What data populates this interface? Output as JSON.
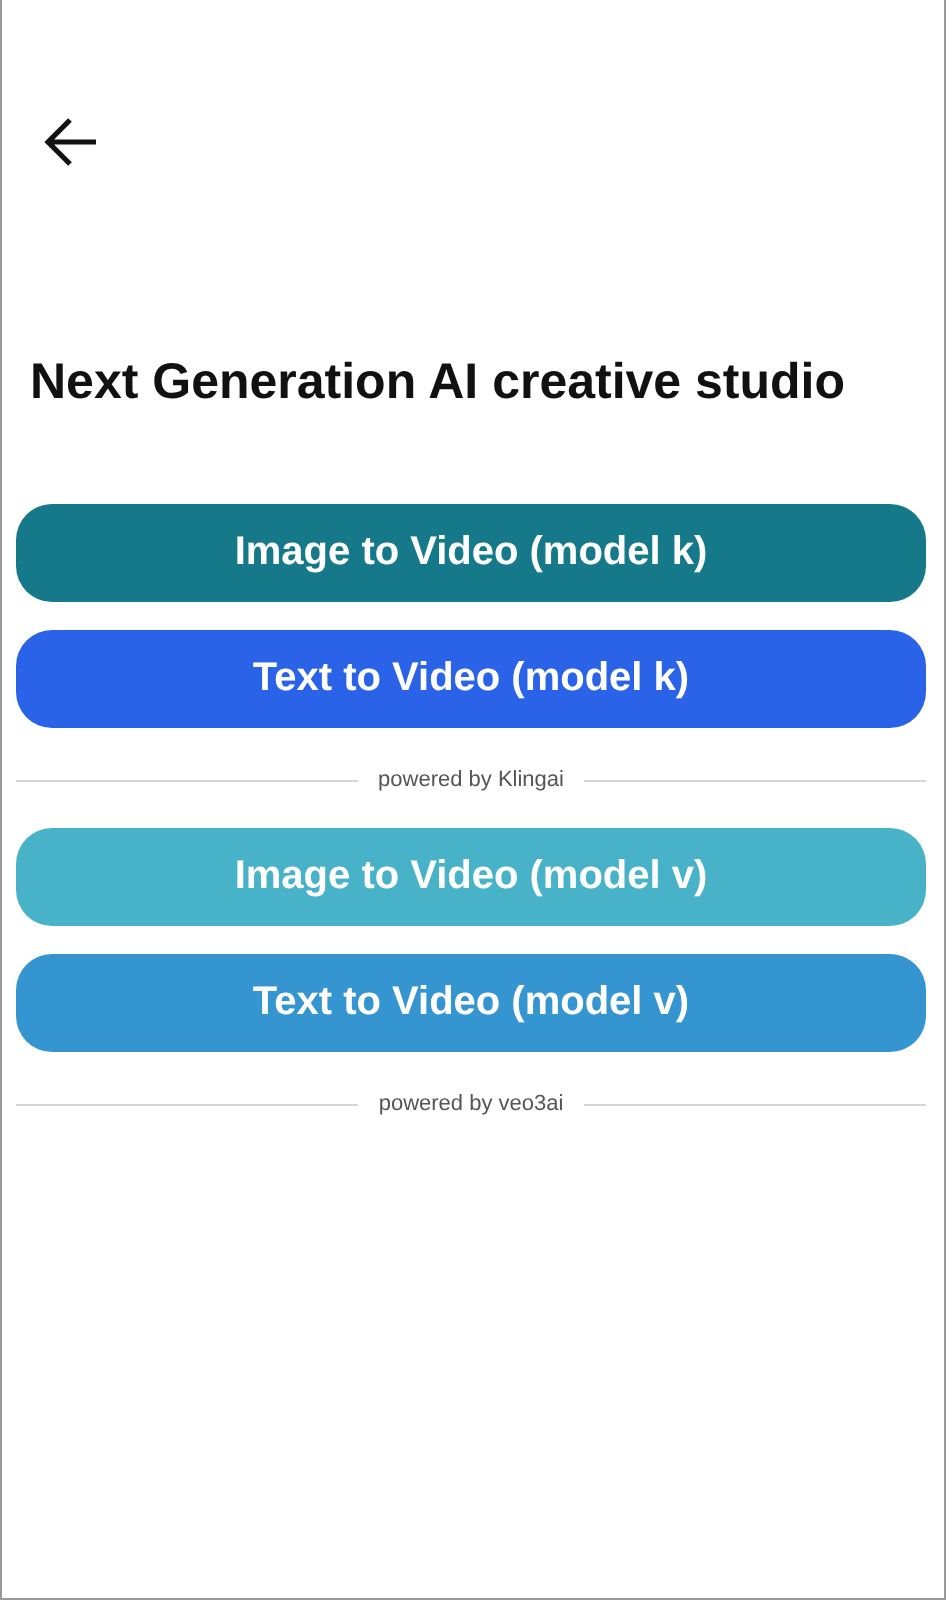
{
  "title": "Next Generation AI creative studio",
  "groups": [
    {
      "buttons": [
        {
          "label": "Image to Video (model k)",
          "color": "#16798a"
        },
        {
          "label": "Text to Video (model k)",
          "color": "#2b63e8"
        }
      ],
      "powered_by": "powered by Klingai"
    },
    {
      "buttons": [
        {
          "label": "Image to Video (model v)",
          "color": "#48b2c8"
        },
        {
          "label": "Text to Video (model v)",
          "color": "#3595d0"
        }
      ],
      "powered_by": "powered by veo3ai"
    }
  ]
}
